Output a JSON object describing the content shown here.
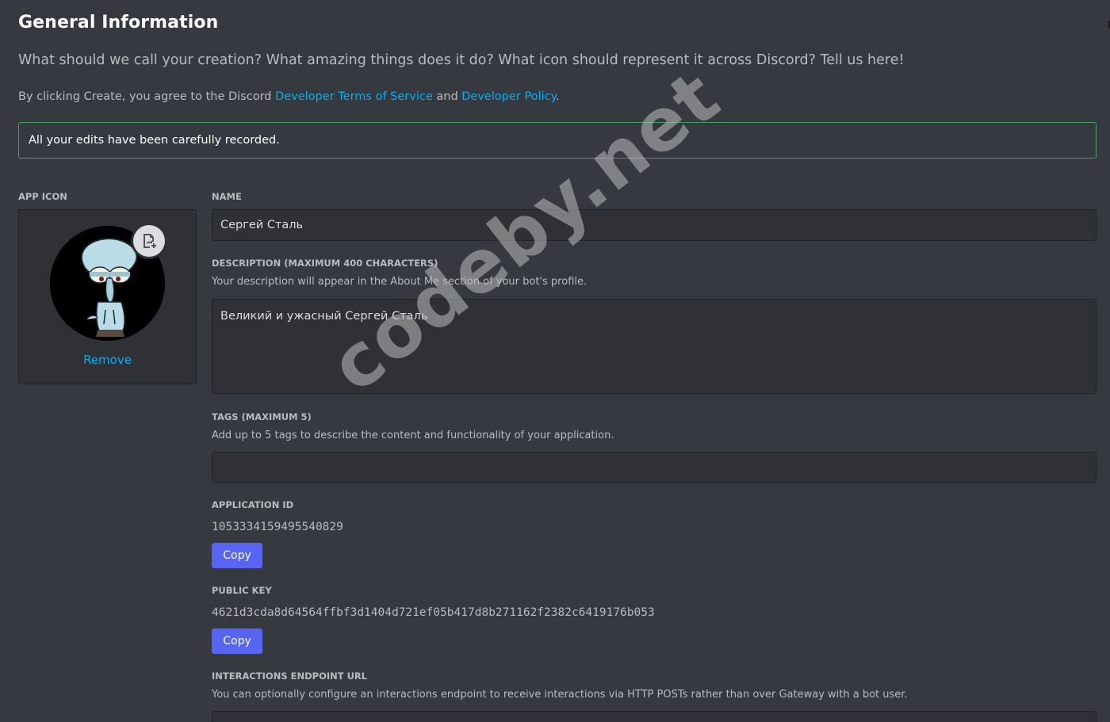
{
  "header": {
    "title": "General Information",
    "subtitle": "What should we call your creation? What amazing things does it do? What icon should represent it across Discord? Tell us here!",
    "terms_prefix": "By clicking Create, you agree to the Discord ",
    "terms_link": "Developer Terms of Service",
    "terms_and": " and ",
    "policy_link": "Developer Policy",
    "terms_suffix": "."
  },
  "notice": {
    "text": "All your edits have been carefully recorded."
  },
  "app_icon": {
    "label": "APP ICON",
    "remove_label": "Remove",
    "upload_icon": "image-add-icon"
  },
  "name": {
    "label": "NAME",
    "value": "Сергей Сталь"
  },
  "description": {
    "label": "DESCRIPTION (MAXIMUM 400 CHARACTERS)",
    "helper": "Your description will appear in the About Me section of your bot's profile.",
    "value": "Великий и ужасный Сергей Сталь"
  },
  "tags": {
    "label": "TAGS (MAXIMUM 5)",
    "helper": "Add up to 5 tags to describe the content and functionality of your application.",
    "value": ""
  },
  "application_id": {
    "label": "APPLICATION ID",
    "value": "1053334159495540829",
    "copy_label": "Copy"
  },
  "public_key": {
    "label": "PUBLIC KEY",
    "value": "4621d3cda8d64564ffbf3d1404d721ef05b417d8b271162f2382c6419176b053",
    "copy_label": "Copy"
  },
  "interactions": {
    "label": "INTERACTIONS ENDPOINT URL",
    "helper": "You can optionally configure an interactions endpoint to receive interactions via HTTP POSTs rather than over Gateway with a bot user.",
    "value": ""
  },
  "watermark": "codeby.net",
  "colors": {
    "background": "#36393f",
    "input_bg": "#2f3136",
    "link": "#00aff4",
    "button": "#5865f2",
    "success_border": "#3ba55d"
  }
}
